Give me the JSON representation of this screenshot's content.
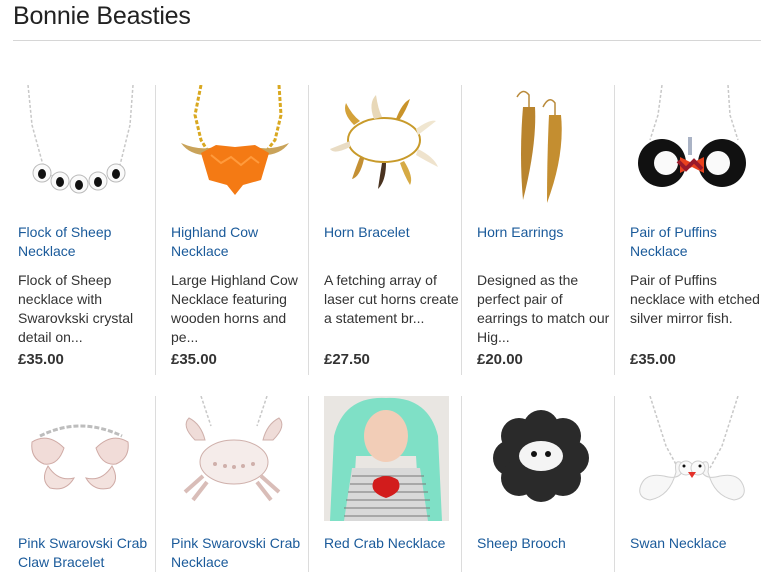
{
  "shop": {
    "title": "Bonnie Beasties"
  },
  "row1": [
    {
      "name": "Flock of Sheep Necklace",
      "desc": "Flock of Sheep necklace with Swarovkski crystal detail on...",
      "price": "£35.00",
      "image": "sheep-necklace-image"
    },
    {
      "name": "Highland Cow Necklace",
      "desc": "Large Highland Cow Necklace featuring wooden horns and pe...",
      "price": "£35.00",
      "image": "highland-cow-necklace-image"
    },
    {
      "name": "Horn Bracelet",
      "desc": "A fetching array of laser cut horns create a statement br...",
      "price": "£27.50",
      "image": "horn-bracelet-image"
    },
    {
      "name": "Horn Earrings",
      "desc": "Designed as the perfect pair of earrings to match our Hig...",
      "price": "£20.00",
      "image": "horn-earrings-image"
    },
    {
      "name": "Pair of Puffins Necklace",
      "desc": "Pair of Puffins necklace with etched silver mirror fish.",
      "price": "£35.00",
      "image": "puffins-necklace-image"
    }
  ],
  "row2": [
    {
      "name": "Pink Swarovski Crab Claw Bracelet",
      "image": "crab-claw-bracelet-image"
    },
    {
      "name": "Pink Swarovski Crab Necklace",
      "image": "crab-necklace-image"
    },
    {
      "name": "Red Crab Necklace",
      "image": "red-crab-necklace-photo"
    },
    {
      "name": "Sheep Brooch",
      "image": "sheep-brooch-image"
    },
    {
      "name": "Swan Necklace",
      "image": "swan-necklace-image"
    }
  ],
  "colors": {
    "link": "#1a5a9a",
    "divider": "#dcdcdc",
    "text": "#333333"
  }
}
